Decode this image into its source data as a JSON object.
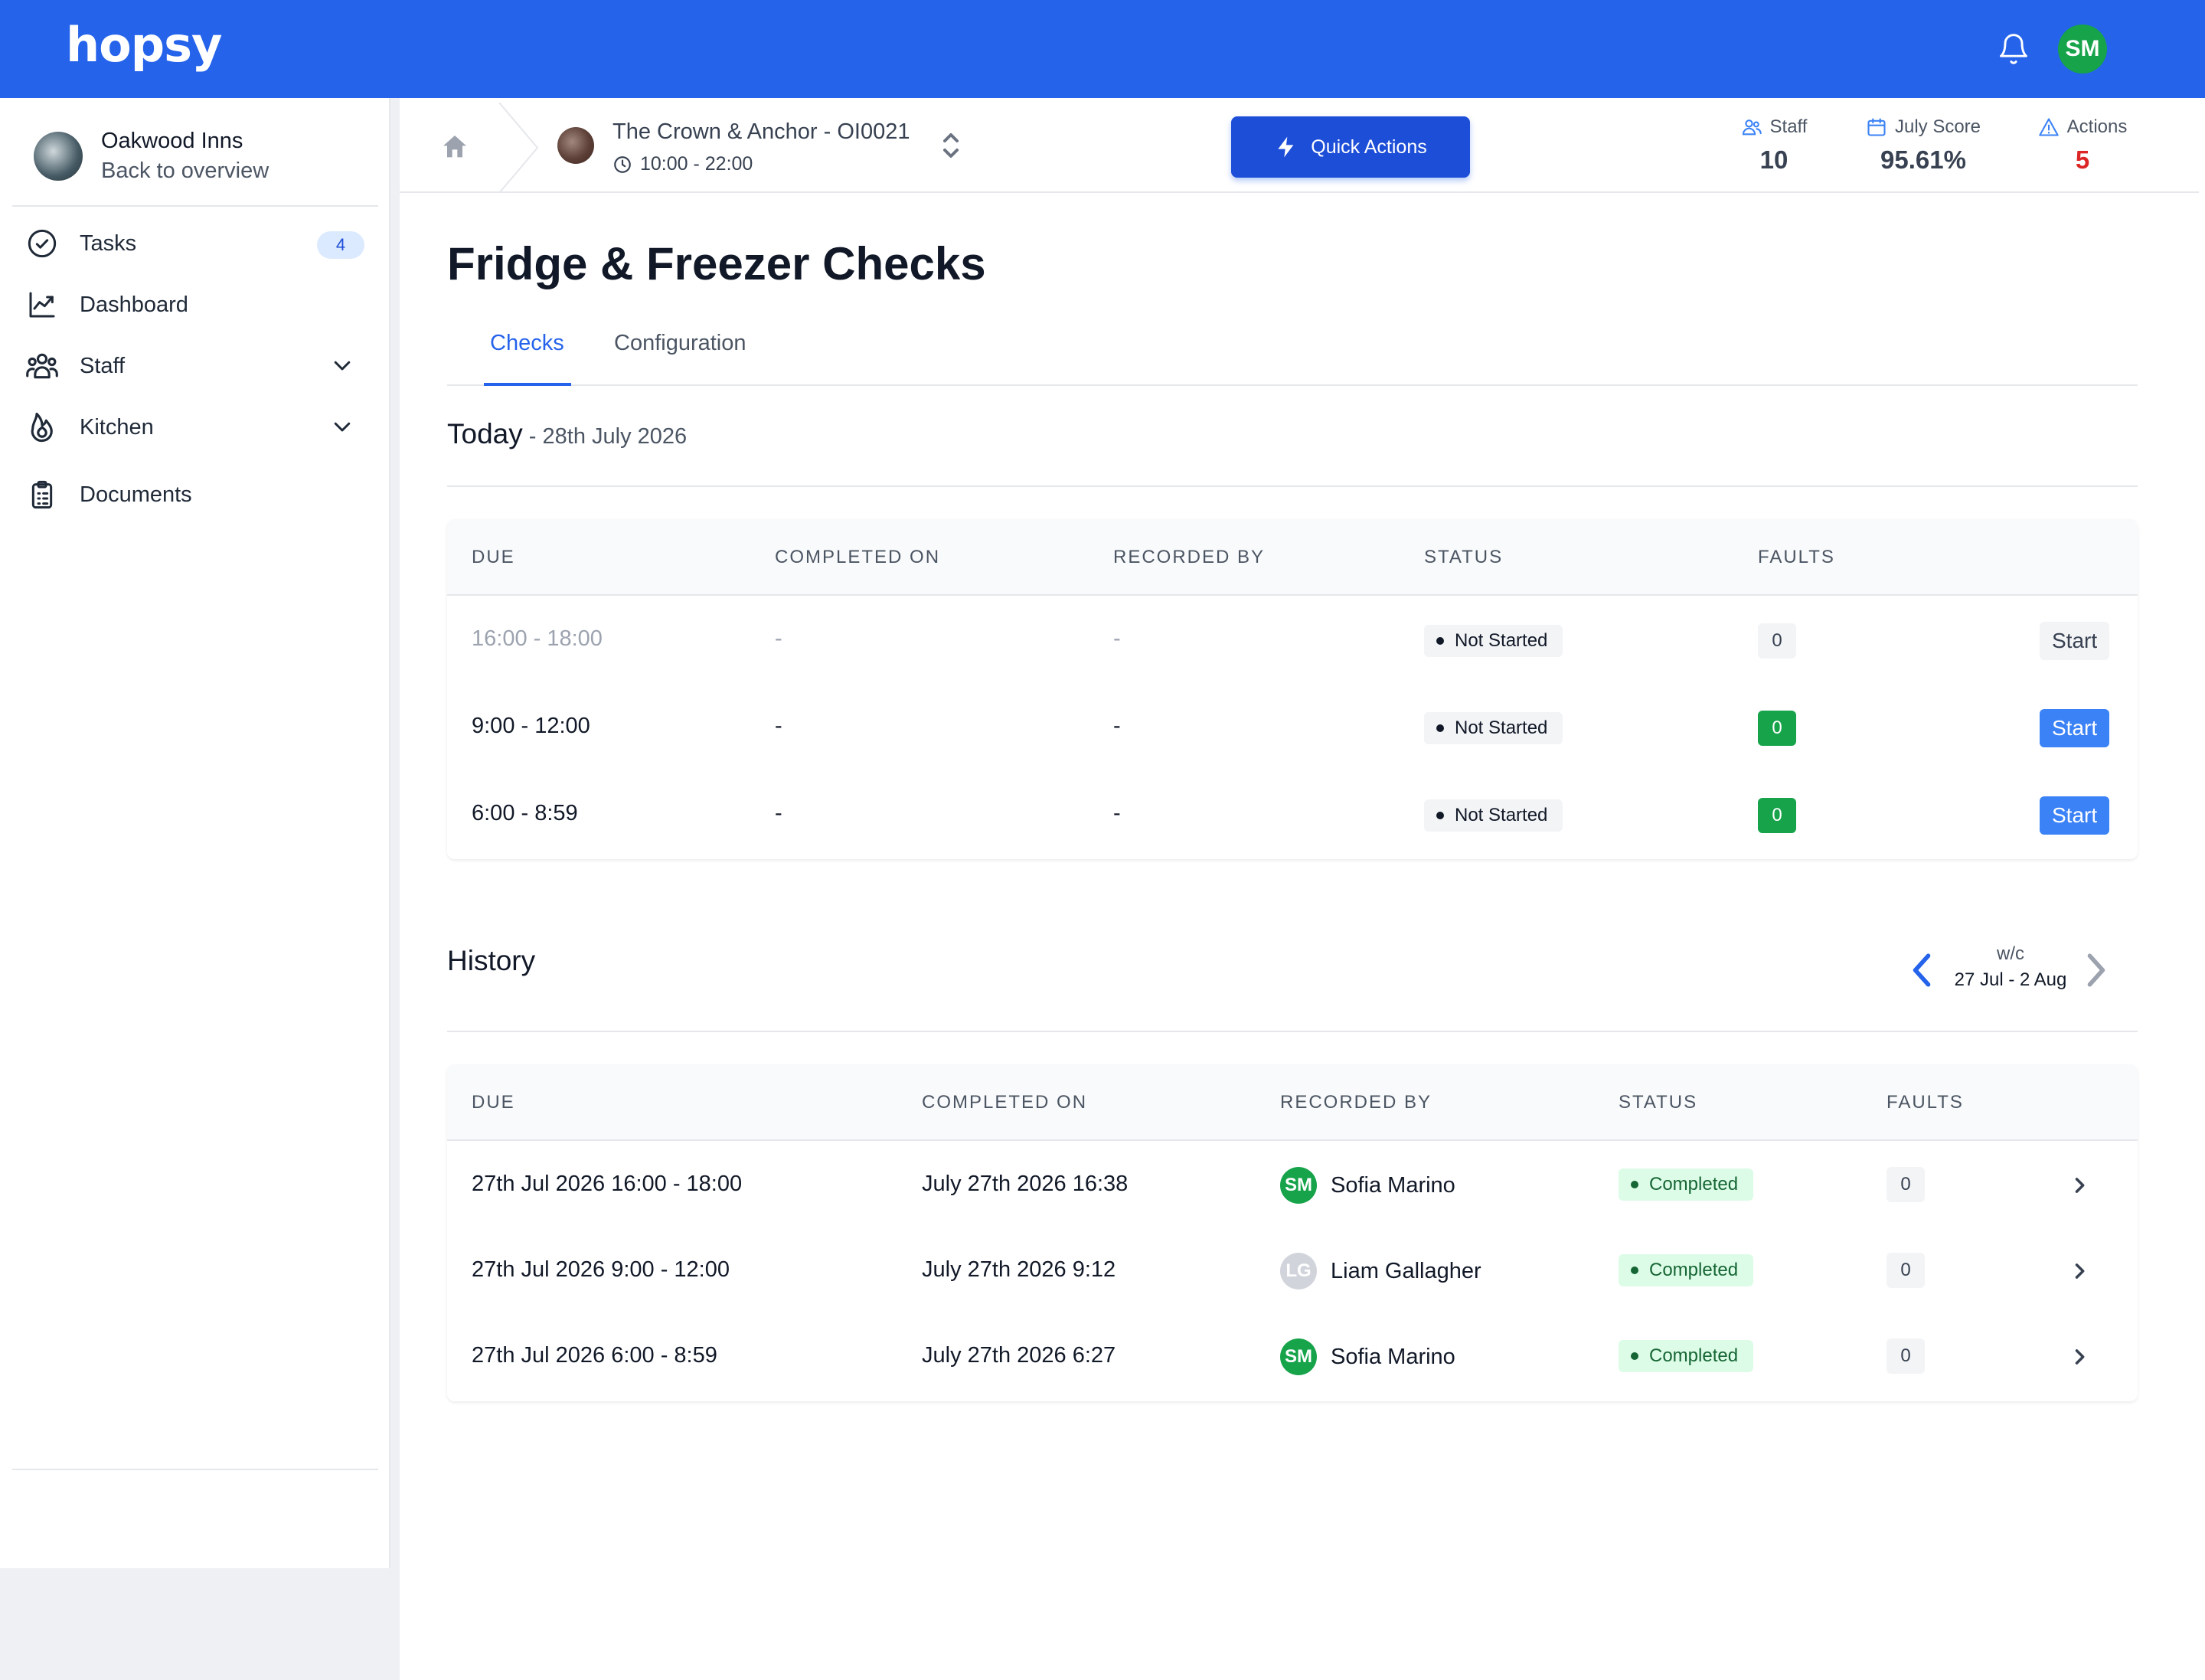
{
  "app": {
    "logo": "hopsy",
    "user_initials": "SM",
    "accent": "#2563eb"
  },
  "sidebar": {
    "org_name": "Oakwood Inns",
    "org_sub": "Back to overview",
    "items": [
      {
        "label": "Tasks",
        "icon": "check-circle-icon",
        "badge": "4"
      },
      {
        "label": "Dashboard",
        "icon": "chart-line-icon"
      },
      {
        "label": "Staff",
        "icon": "people-icon",
        "expandable": true
      },
      {
        "label": "Kitchen",
        "icon": "flame-icon",
        "expandable": true
      },
      {
        "label": "Documents",
        "icon": "clipboard-icon"
      }
    ]
  },
  "context": {
    "site_name": "The Crown & Anchor - OI0021",
    "site_hours": "10:00 - 22:00",
    "quick_actions": "Quick Actions",
    "stats": [
      {
        "label": "Staff",
        "value": "10"
      },
      {
        "label": "July Score",
        "value": "95.61%"
      },
      {
        "label": "Actions",
        "value": "5"
      }
    ]
  },
  "page": {
    "title": "Fridge & Freezer Checks",
    "tabs": [
      "Checks",
      "Configuration"
    ],
    "today_label": "Today",
    "today_date": " - 28th July 2026",
    "history_label": "History",
    "week_prefix": "w/c",
    "week_range": "27 Jul - 2 Aug"
  },
  "today_table": {
    "headers": [
      "DUE",
      "COMPLETED ON",
      "RECORDED BY",
      "STATUS",
      "FAULTS"
    ],
    "rows": [
      {
        "due": "16:00 - 18:00",
        "completed": "-",
        "recorded": "-",
        "status": "Not Started",
        "faults": "0",
        "action": "Start"
      },
      {
        "due": "9:00 - 12:00",
        "completed": "-",
        "recorded": "-",
        "status": "Not Started",
        "faults": "0",
        "action": "Start"
      },
      {
        "due": "6:00 - 8:59",
        "completed": "-",
        "recorded": "-",
        "status": "Not Started",
        "faults": "0",
        "action": "Start"
      }
    ]
  },
  "history_table": {
    "headers": [
      "DUE",
      "COMPLETED ON",
      "RECORDED BY",
      "STATUS",
      "FAULTS"
    ],
    "rows": [
      {
        "due": "27th Jul 2026 16:00 - 18:00",
        "completed": "July 27th 2026 16:38",
        "initials": "SM",
        "recorded": "Sofia Marino",
        "status": "Completed",
        "faults": "0"
      },
      {
        "due": "27th Jul 2026 9:00 - 12:00",
        "completed": "July 27th 2026 9:12",
        "initials": "LG",
        "recorded": "Liam Gallagher",
        "status": "Completed",
        "faults": "0"
      },
      {
        "due": "27th Jul 2026 6:00 - 8:59",
        "completed": "July 27th 2026 6:27",
        "initials": "SM",
        "recorded": "Sofia Marino",
        "status": "Completed",
        "faults": "0"
      }
    ]
  }
}
